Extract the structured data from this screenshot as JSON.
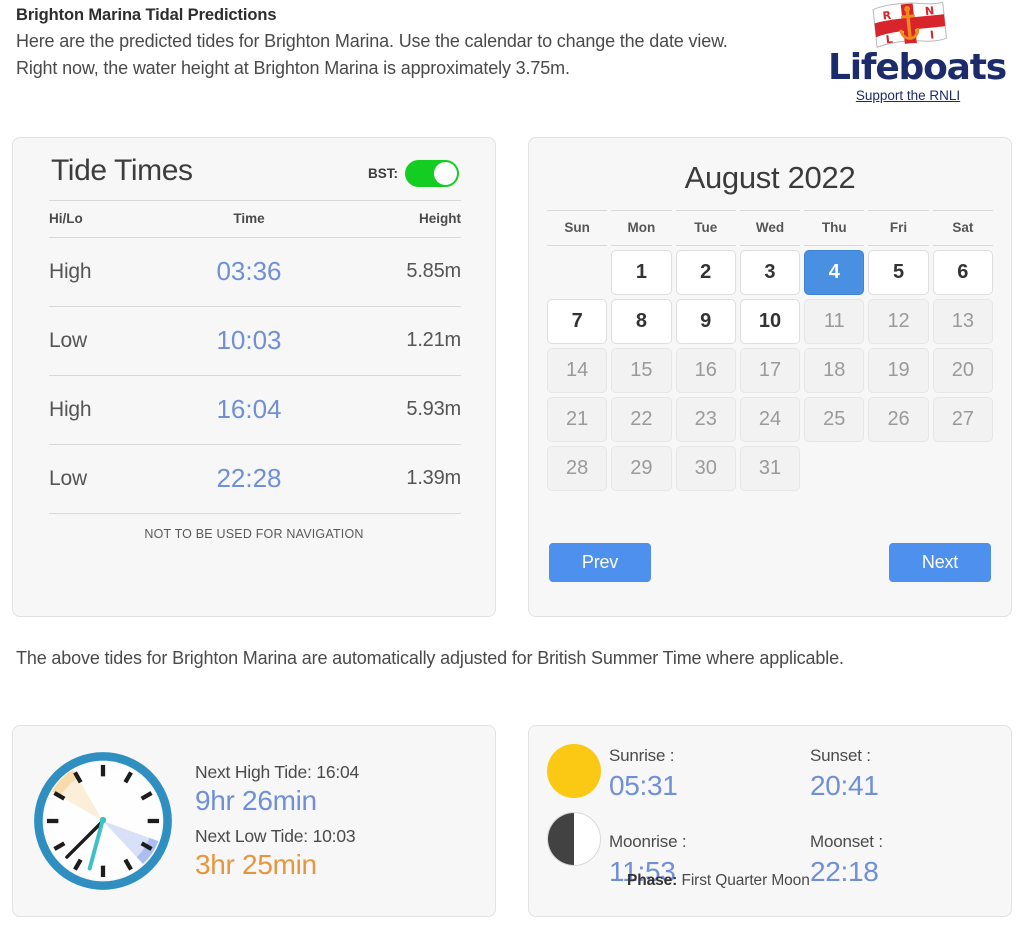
{
  "header": {
    "title": "Brighton Marina Tidal Predictions",
    "intro_line1": "Here are the predicted tides for Brighton Marina. Use the calendar to change the date view.",
    "intro_line2": "Right now, the water height at Brighton Marina is approximately 3.75m.",
    "logo": {
      "wordmark": "Lifeboats",
      "support_link": "Support the RNLI",
      "flag_letters": [
        "R",
        "N",
        "L",
        "I"
      ],
      "brand_color": "#1b2b6b",
      "flag_cross_color": "#d8252b",
      "anchor_color": "#f08a1e"
    }
  },
  "tide_card": {
    "title": "Tide Times",
    "bst_label": "BST:",
    "bst_enabled": true,
    "bst_color": "#15cc22",
    "columns": [
      "Hi/Lo",
      "Time",
      "Height"
    ],
    "rows": [
      {
        "hilo": "High",
        "time": "03:36",
        "height": "5.85m"
      },
      {
        "hilo": "Low",
        "time": "10:03",
        "height": "1.21m"
      },
      {
        "hilo": "High",
        "time": "16:04",
        "height": "5.93m"
      },
      {
        "hilo": "Low",
        "time": "22:28",
        "height": "1.39m"
      }
    ],
    "footer_note": "NOT TO BE USED FOR NAVIGATION",
    "time_color": "#6f8fd6"
  },
  "calendar": {
    "title": "August 2022",
    "day_names": [
      "Sun",
      "Mon",
      "Tue",
      "Wed",
      "Thu",
      "Fri",
      "Sat"
    ],
    "leading_blanks": 1,
    "selected_day": 4,
    "last_enabled_day": 10,
    "days": [
      1,
      2,
      3,
      4,
      5,
      6,
      7,
      8,
      9,
      10,
      11,
      12,
      13,
      14,
      15,
      16,
      17,
      18,
      19,
      20,
      21,
      22,
      23,
      24,
      25,
      26,
      27,
      28,
      29,
      30,
      31
    ],
    "prev_label": "Prev",
    "next_label": "Next",
    "accent_color": "#4a90e2",
    "button_color": "#4d90ee"
  },
  "mid_note": "The above tides for Brighton Marina are automatically adjusted for British Summer Time where applicable.",
  "clock_card": {
    "next_high_label": "Next High Tide: 16:04",
    "next_high_countdown": "9hr 26min",
    "next_low_label": "Next Low Tide: 10:03",
    "next_low_countdown": "3hr 25min",
    "high_color": "#6f8fd6",
    "low_color": "#e5963f",
    "clock_ring_color": "#2e8fc0",
    "clock_high_marker_color": "#f8d9a5",
    "clock_low_marker_color": "#a8b9ee"
  },
  "sun_card": {
    "sunrise_label": "Sunrise :",
    "sunrise_value": "05:31",
    "sunset_label": "Sunset :",
    "sunset_value": "20:41",
    "moonrise_label": "Moonrise :",
    "moonrise_value": "11:53",
    "moonset_label": "Moonset :",
    "moonset_value": "22:18",
    "phase_label": "Phase:",
    "phase_value": "First Quarter Moon",
    "sun_color": "#fbc913",
    "moon_dark_color": "#424242",
    "value_color": "#6f8fd6"
  }
}
